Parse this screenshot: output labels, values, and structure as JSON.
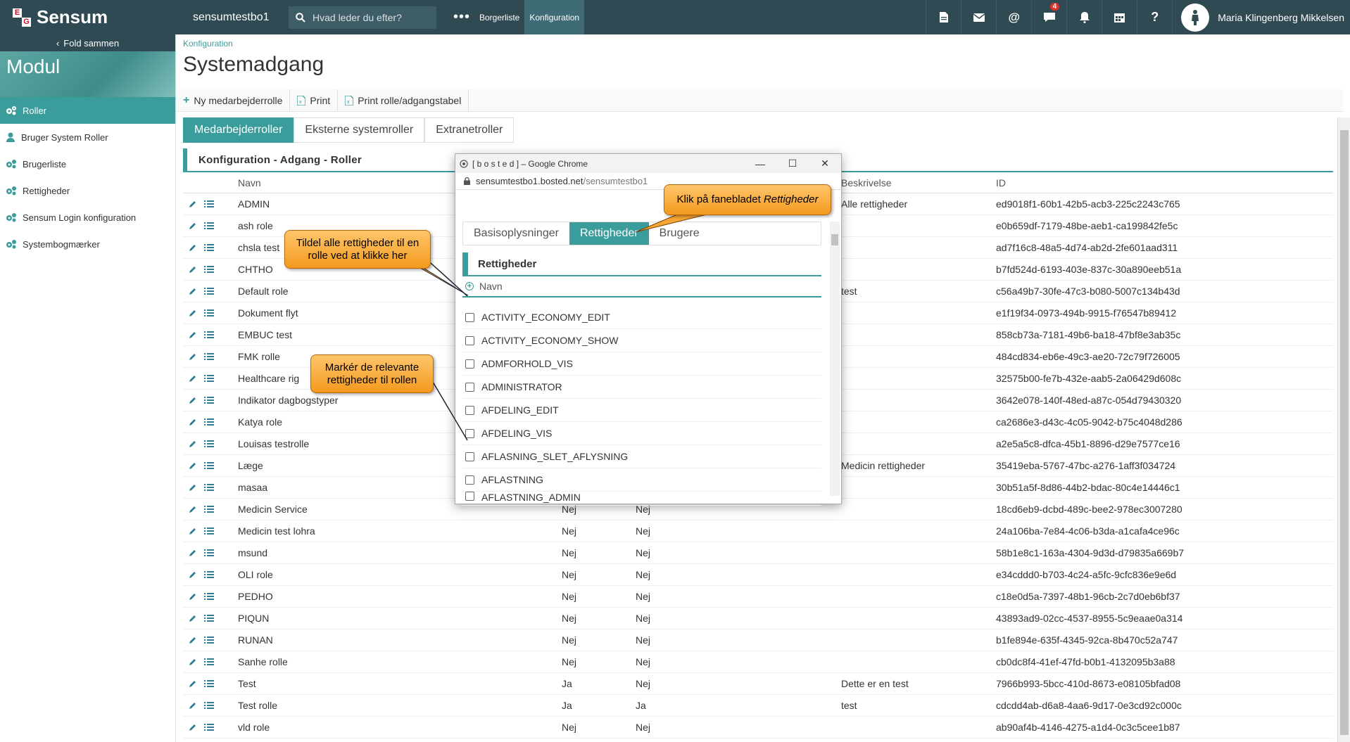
{
  "brand": {
    "logo_letters": [
      "E",
      "G"
    ],
    "name": "Sensum"
  },
  "header": {
    "site": "sensumtestbo1",
    "search_placeholder": "Hvad leder du efter?",
    "nav": [
      {
        "label": "Borgerliste"
      },
      {
        "label": "Konfiguration"
      }
    ],
    "notification_count": "4",
    "user_name": "Maria Klingenberg Mikkelsen"
  },
  "sidebar": {
    "fold_label": "Fold sammen",
    "module_title": "Modul",
    "items": [
      {
        "label": "Roller",
        "icon": "gears-icon"
      },
      {
        "label": "Bruger System Roller",
        "icon": "user-icon"
      },
      {
        "label": "Brugerliste",
        "icon": "gears-icon"
      },
      {
        "label": "Rettigheder",
        "icon": "gears-icon"
      },
      {
        "label": "Sensum Login konfiguration",
        "icon": "gears-icon"
      },
      {
        "label": "Systembogmærker",
        "icon": "gears-icon"
      }
    ]
  },
  "page": {
    "breadcrumb": "Konfiguration",
    "title": "Systemadgang",
    "toolbar": {
      "new_role": "Ny medarbejderrolle",
      "print": "Print",
      "print_table": "Print rolle/adgangstabel"
    },
    "tabs": [
      "Medarbejderroller",
      "Eksterne systemroller",
      "Extranetroller"
    ],
    "panel_title": "Konfiguration - Adgang - Roller",
    "columns": {
      "name": "Navn",
      "description": "Beskrivelse",
      "id": "ID"
    },
    "rows": [
      {
        "name": "ADMIN",
        "a": "",
        "b": "",
        "desc": "Alle rettigheder",
        "id": "ed9018f1-60b1-42b5-acb3-225c2243c765"
      },
      {
        "name": "ash role",
        "a": "",
        "b": "",
        "desc": "",
        "id": "e0b659df-7179-48be-aeb1-ca199842fe5c"
      },
      {
        "name": "chsla test",
        "a": "",
        "b": "",
        "desc": "",
        "id": "ad7f16c8-48a5-4d74-ab2d-2fe601aad311"
      },
      {
        "name": "CHTHO",
        "a": "",
        "b": "",
        "desc": "",
        "id": "b7fd524d-6193-403e-837c-30a890eeb51a"
      },
      {
        "name": "Default role",
        "a": "",
        "b": "",
        "desc": "test",
        "id": "c56a49b7-30fe-47c3-b080-5007c134b43d"
      },
      {
        "name": "Dokument flyt",
        "a": "",
        "b": "",
        "desc": "",
        "id": "e1f19f34-0973-494b-9915-f76547b89412"
      },
      {
        "name": "EMBUC test",
        "a": "",
        "b": "",
        "desc": "",
        "id": "858cb73a-7181-49b6-ba18-47bf8e3ab35c"
      },
      {
        "name": "FMK rolle",
        "a": "",
        "b": "",
        "desc": "",
        "id": "484cd834-eb6e-49c3-ae20-72c79f726005"
      },
      {
        "name": "Healthcare rig",
        "a": "",
        "b": "",
        "desc": "",
        "id": "32575b00-fe7b-432e-aab5-2a06429d608c"
      },
      {
        "name": "Indikator dagbogstyper",
        "a": "",
        "b": "",
        "desc": "",
        "id": "3642e078-140f-48ed-a87c-054d79430320"
      },
      {
        "name": "Katya role",
        "a": "",
        "b": "",
        "desc": "",
        "id": "ca2686e3-d43c-4c05-9042-b75c4048d286"
      },
      {
        "name": "Louisas testrolle",
        "a": "",
        "b": "",
        "desc": "",
        "id": "a2e5a5c8-dfca-45b1-8896-d29e7577ce16"
      },
      {
        "name": "Læge",
        "a": "",
        "b": "",
        "desc": "Medicin rettigheder",
        "id": "35419eba-5767-47bc-a276-1aff3f034724"
      },
      {
        "name": "masaa",
        "a": "",
        "b": "",
        "desc": "",
        "id": "30b51a5f-8d86-44b2-bdac-80c4e14446c1"
      },
      {
        "name": "Medicin Service",
        "a": "Nej",
        "b": "Nej",
        "desc": "",
        "id": "18cd6eb9-dcbd-489c-bee2-978ec3007280"
      },
      {
        "name": "Medicin test lohra",
        "a": "Nej",
        "b": "Nej",
        "desc": "",
        "id": "24a106ba-7e84-4c06-b3da-a1cafa4ce96c"
      },
      {
        "name": "msund",
        "a": "Nej",
        "b": "Nej",
        "desc": "",
        "id": "58b1e8c1-163a-4304-9d3d-d79835a669b7"
      },
      {
        "name": "OLI role",
        "a": "Nej",
        "b": "Nej",
        "desc": "",
        "id": "e34cddd0-b703-4c24-a5fc-9cfc836e9e6d"
      },
      {
        "name": "PEDHO",
        "a": "Nej",
        "b": "Nej",
        "desc": "",
        "id": "c18e0d5a-7397-48b1-96cb-2c7d0eb6bf37"
      },
      {
        "name": "PIQUN",
        "a": "Nej",
        "b": "Nej",
        "desc": "",
        "id": "43893ad9-02cc-4537-8955-5c9eaae0a314"
      },
      {
        "name": "RUNAN",
        "a": "Nej",
        "b": "Nej",
        "desc": "",
        "id": "b1fe894e-635f-4345-92ca-8b470c52a747"
      },
      {
        "name": "Sanhe rolle",
        "a": "Nej",
        "b": "Nej",
        "desc": "",
        "id": "cb0dc8f4-41ef-47fd-b0b1-4132095b3a88"
      },
      {
        "name": "Test",
        "a": "Ja",
        "b": "Nej",
        "desc": "Dette er en test",
        "id": "7966b993-5bcc-410d-8673-e08105bfad08"
      },
      {
        "name": "Test rolle",
        "a": "Ja",
        "b": "Ja",
        "desc": "test",
        "id": "cdcdd4ab-d6a8-4aa6-9d17-0e3cd92c000c"
      },
      {
        "name": "vld role",
        "a": "Nej",
        "b": "Nej",
        "desc": "",
        "id": "ab90af4b-4146-4275-a1d4-0c3c5cee1b87"
      }
    ]
  },
  "popup": {
    "window_title": "[ b o s t e d ] – Google Chrome",
    "address_host": "sensumtestbo1.bosted.net",
    "address_path": "/sensumtestbo1",
    "tabs": [
      "Basisoplysninger",
      "Rettigheder",
      "Brugere"
    ],
    "section_title": "Rettigheder",
    "column_name": "Navn",
    "items": [
      "ACTIVITY_ECONOMY_EDIT",
      "ACTIVITY_ECONOMY_SHOW",
      "ADMFORHOLD_VIS",
      "ADMINISTRATOR",
      "AFDELING_EDIT",
      "AFDELING_VIS",
      "AFLASNING_SLET_AFLYSNING",
      "AFLASTNING",
      "AFLASTNING_ADMIN"
    ]
  },
  "callouts": {
    "tab_hint": "Klik på fanebladet ",
    "tab_hint_em": "Rettigheder",
    "all_rights": "Tildel alle rettigheder til en rolle ved at klikke her",
    "mark_rights": "Markér de relevante rettigheder til rollen"
  },
  "colors": {
    "accent": "#3a9c9b",
    "topbar": "#2f4a52",
    "callout": "#f7a733"
  }
}
